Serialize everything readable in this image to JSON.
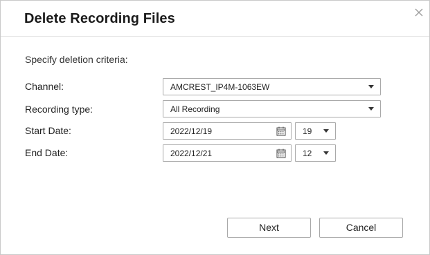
{
  "dialog": {
    "title": "Delete Recording Files",
    "close_icon": "close-icon"
  },
  "form": {
    "criteria_label": "Specify deletion criteria:",
    "channel": {
      "label": "Channel:",
      "value": "AMCREST_IP4M-1063EW"
    },
    "recording_type": {
      "label": "Recording type:",
      "value": "All Recording"
    },
    "start_date": {
      "label": "Start Date:",
      "date": "2022/12/19",
      "hour": "19",
      "calendar_icon": "calendar-icon"
    },
    "end_date": {
      "label": "End Date:",
      "date": "2022/12/21",
      "hour": "12",
      "calendar_icon": "calendar-icon"
    }
  },
  "buttons": {
    "next_label": "Next",
    "cancel_label": "Cancel"
  }
}
